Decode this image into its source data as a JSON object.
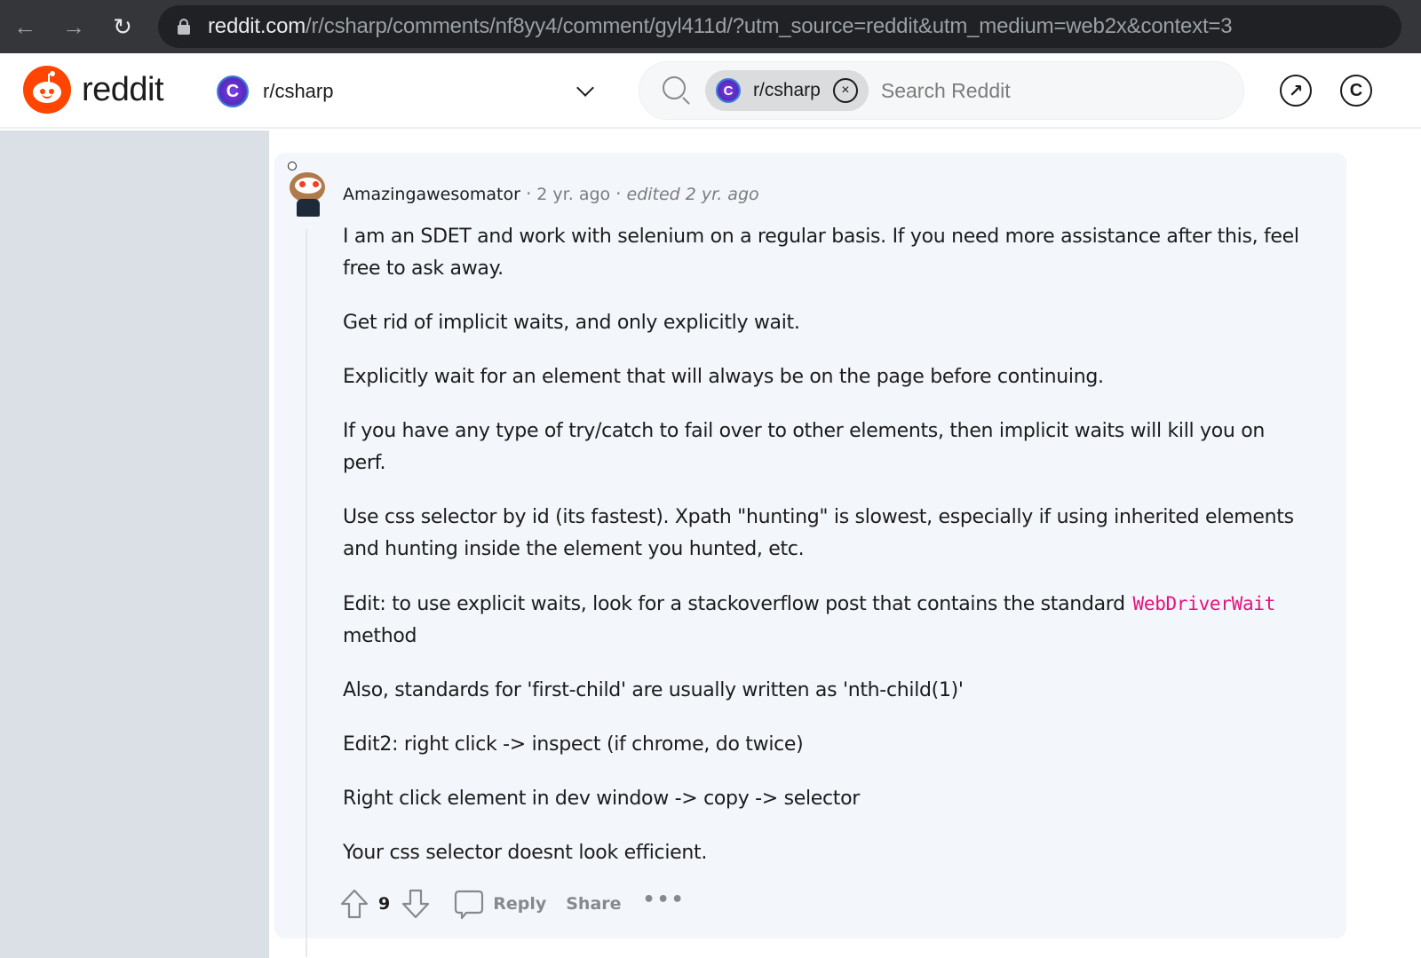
{
  "browser": {
    "url_host": "reddit.com",
    "url_path": "/r/csharp/comments/nf8yy4/comment/gyl411d/?utm_source=reddit&utm_medium=web2x&context=3",
    "back_icon": "←",
    "forward_icon": "→",
    "reload_icon": "↻"
  },
  "header": {
    "wordmark": "reddit",
    "community": "r/csharp",
    "community_icon_glyph": "C",
    "search": {
      "scope_chip": "r/csharp",
      "chip_close_glyph": "×",
      "placeholder": "Search Reddit"
    },
    "open_app_glyph": "↗",
    "coins_glyph": "C"
  },
  "comment": {
    "author": "Amazingawesomator",
    "separator": "·",
    "age": "2 yr. ago",
    "edited": "edited 2 yr. ago",
    "paragraphs": [
      "I am an SDET and work with selenium on a regular basis. If you need more assistance after this, feel free to ask away.",
      "Get rid of implicit waits, and only explicitly wait.",
      "Explicitly wait for an element that will always be on the page before continuing.",
      "If you have any type of try/catch to fail over to other elements, then implicit waits will kill you on perf.",
      "Use css selector by id (its fastest). Xpath \"hunting\" is slowest, especially if using inherited elements and hunting inside the element you hunted, etc."
    ],
    "edit_paragraph": {
      "before": "Edit: to use explicit waits, look for a stackoverflow post that contains the standard ",
      "code": "WebDriverWait",
      "after": " method"
    },
    "paragraphs_after": [
      "Also, standards for 'first-child' are usually written as 'nth-child(1)'",
      "Edit2: right click -> inspect (if chrome, do twice)",
      "Right click element in dev window -> copy -> selector",
      "Your css selector doesnt look efficient."
    ],
    "score": "9",
    "reply_label": "Reply",
    "share_label": "Share",
    "more_glyph": "•••"
  }
}
